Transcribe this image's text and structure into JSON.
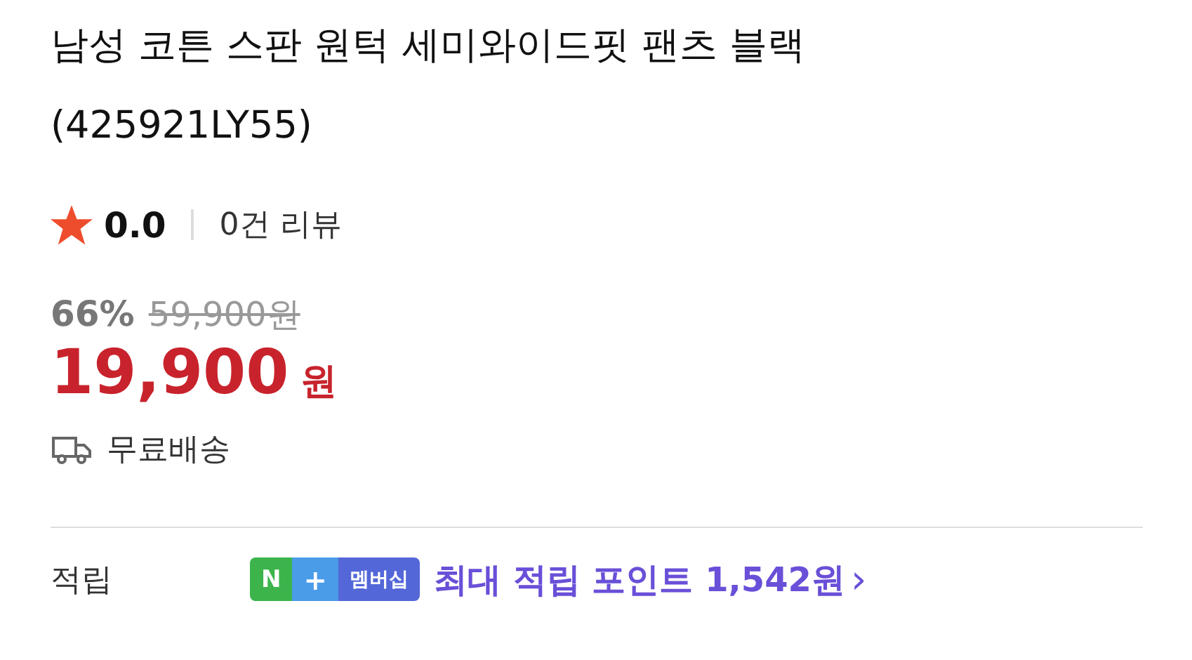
{
  "title": "남성 코튼 스판 원턱 세미와이드핏 팬츠 블랙 (425921LY55)",
  "rating": {
    "score": "0.0",
    "reviews": "0건 리뷰"
  },
  "price": {
    "discount": "66%",
    "original": "59,900원",
    "sale": "19,900",
    "unit": "원"
  },
  "shipping": "무료배송",
  "points": {
    "label": "적립",
    "badge": [
      "N",
      "+",
      "멤버십"
    ],
    "text": "최대 적립 포인트 1,542원",
    "arrow": "›"
  }
}
